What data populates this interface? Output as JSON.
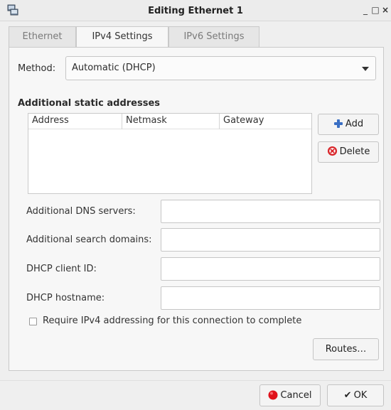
{
  "window": {
    "title": "Editing Ethernet 1",
    "minimize": "_",
    "maximize": "□",
    "close": "×"
  },
  "tabs": [
    {
      "label": "Ethernet",
      "active": false
    },
    {
      "label": "IPv4 Settings",
      "active": true
    },
    {
      "label": "IPv6 Settings",
      "active": false
    }
  ],
  "method": {
    "label": "Method:",
    "value": "Automatic (DHCP)"
  },
  "static_addresses": {
    "title": "Additional static addresses",
    "columns": [
      "Address",
      "Netmask",
      "Gateway"
    ],
    "rows": [],
    "add_label": "Add",
    "delete_label": "Delete"
  },
  "fields": {
    "dns": {
      "label": "Additional DNS servers:",
      "value": ""
    },
    "search": {
      "label": "Additional search domains:",
      "value": ""
    },
    "client_id": {
      "label": "DHCP client ID:",
      "value": ""
    },
    "hostname": {
      "label": "DHCP hostname:",
      "value": ""
    }
  },
  "require_ipv4": {
    "label": "Require IPv4 addressing for this connection to complete",
    "checked": false
  },
  "routes_label": "Routes…",
  "footer": {
    "cancel_label": "Cancel",
    "ok_label": "OK"
  },
  "icons": {
    "app": "network-icon",
    "add": "plus-icon",
    "delete": "delete-icon",
    "cancel": "cancel-icon",
    "ok": "checkmark-icon"
  },
  "colors": {
    "add_icon": "#3a6fc4",
    "delete_icon": "#d9262b",
    "cancel_icon": "#e0121b"
  }
}
